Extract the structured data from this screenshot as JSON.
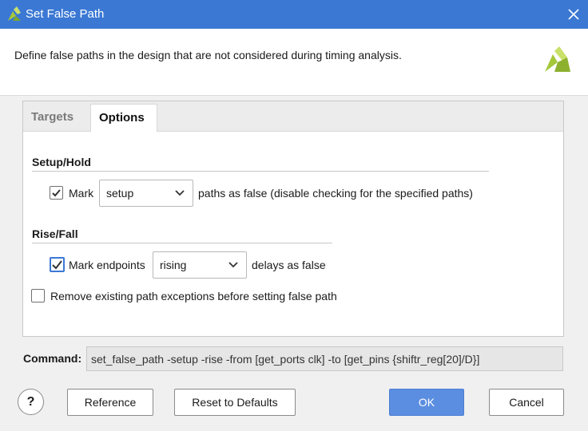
{
  "window": {
    "title": "Set False Path",
    "description": "Define false paths in the design that are not considered during timing analysis."
  },
  "tabs": [
    {
      "label": "Targets",
      "active": false
    },
    {
      "label": "Options",
      "active": true
    }
  ],
  "setup_hold": {
    "title": "Setup/Hold",
    "checkbox_checked": true,
    "mark_label": "Mark",
    "select_value": "setup",
    "suffix_text": "paths as false (disable checking for the specified paths)"
  },
  "rise_fall": {
    "title": "Rise/Fall",
    "checkbox_checked": true,
    "mark_label": "Mark endpoints",
    "select_value": "rising",
    "suffix_text": "delays as false"
  },
  "remove_existing": {
    "checkbox_checked": false,
    "label": "Remove existing path exceptions before setting false path"
  },
  "command": {
    "label": "Command:",
    "value": "set_false_path -setup -rise -from [get_ports clk] -to [get_pins {shiftr_reg[20]/D}]"
  },
  "buttons": {
    "help": "?",
    "reference": "Reference",
    "reset": "Reset to Defaults",
    "ok": "OK",
    "cancel": "Cancel"
  },
  "colors": {
    "titlebar": "#3b78d4",
    "ok_button": "#5b8ee0",
    "logo": "#a4c839"
  }
}
